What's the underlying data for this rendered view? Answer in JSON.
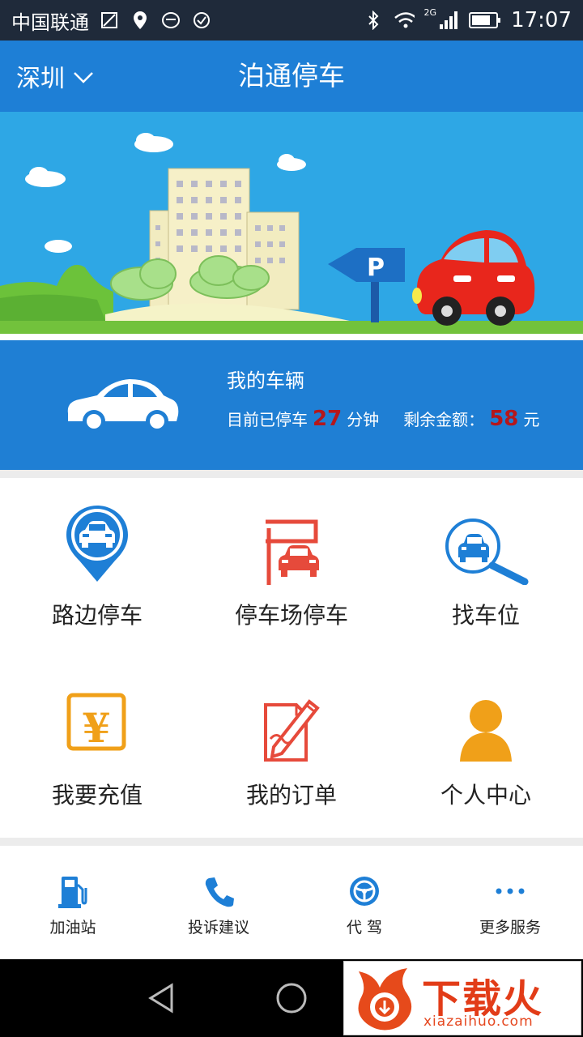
{
  "status_bar": {
    "carrier": "中国联通",
    "network": "2G",
    "time": "17:07"
  },
  "app_bar": {
    "city": "深圳",
    "title": "泊通停车"
  },
  "vehicle": {
    "title": "我的车辆",
    "parked_prefix": "目前已停车",
    "parked_minutes": "27",
    "parked_unit": "分钟",
    "balance_prefix": "剩余金额：",
    "balance_value": "58",
    "balance_unit": "元"
  },
  "grid": [
    {
      "label": "路边停车",
      "icon": "roadside-parking-pin-icon"
    },
    {
      "label": "停车场停车",
      "icon": "parking-lot-icon"
    },
    {
      "label": "找车位",
      "icon": "find-space-magnifier-icon"
    },
    {
      "label": "我要充值",
      "icon": "yuan-recharge-icon"
    },
    {
      "label": "我的订单",
      "icon": "order-edit-icon"
    },
    {
      "label": "个人中心",
      "icon": "person-icon"
    }
  ],
  "services": [
    {
      "label": "加油站",
      "icon": "fuel-pump-icon"
    },
    {
      "label": "投诉建议",
      "icon": "phone-icon"
    },
    {
      "label": "代  驾",
      "icon": "steering-wheel-icon"
    },
    {
      "label": "更多服务",
      "icon": "more-dots-icon"
    }
  ],
  "watermark": {
    "brand": "下载火",
    "url": "xiazaihuo.com"
  },
  "colors": {
    "primary_blue": "#1e7fd6",
    "accent_red": "#e64a3b",
    "accent_orange": "#f0a019",
    "number_red": "#b5171b"
  }
}
